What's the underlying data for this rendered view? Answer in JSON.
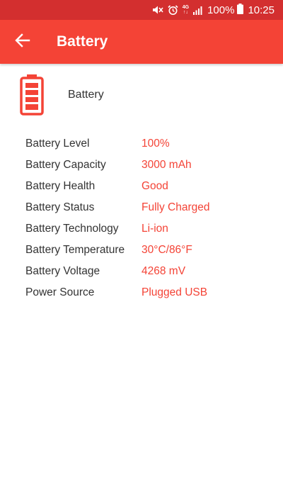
{
  "status_bar": {
    "network_label_top": "4G",
    "network_label_bottom": "↑↓",
    "battery_percent": "100%",
    "time": "10:25",
    "icons": [
      "mute-icon",
      "alarm-icon",
      "network-4g-icon",
      "signal-icon",
      "battery-status-icon"
    ]
  },
  "app_bar": {
    "title": "Battery",
    "back_icon": "arrow-back-icon"
  },
  "header": {
    "label": "Battery",
    "icon": "battery-full-icon"
  },
  "colors": {
    "status_bar": "#d32f2f",
    "app_bar": "#f44336",
    "accent": "#f44336",
    "text": "#333333"
  },
  "info": [
    {
      "label": "Battery Level",
      "value": "100%"
    },
    {
      "label": "Battery Capacity",
      "value": "3000 mAh"
    },
    {
      "label": "Battery Health",
      "value": "Good"
    },
    {
      "label": "Battery Status",
      "value": "Fully Charged"
    },
    {
      "label": "Battery Technology",
      "value": "Li-ion"
    },
    {
      "label": "Battery Temperature",
      "value": "30°C/86°F"
    },
    {
      "label": "Battery Voltage",
      "value": "4268 mV"
    },
    {
      "label": "Power Source",
      "value": "Plugged USB"
    }
  ]
}
